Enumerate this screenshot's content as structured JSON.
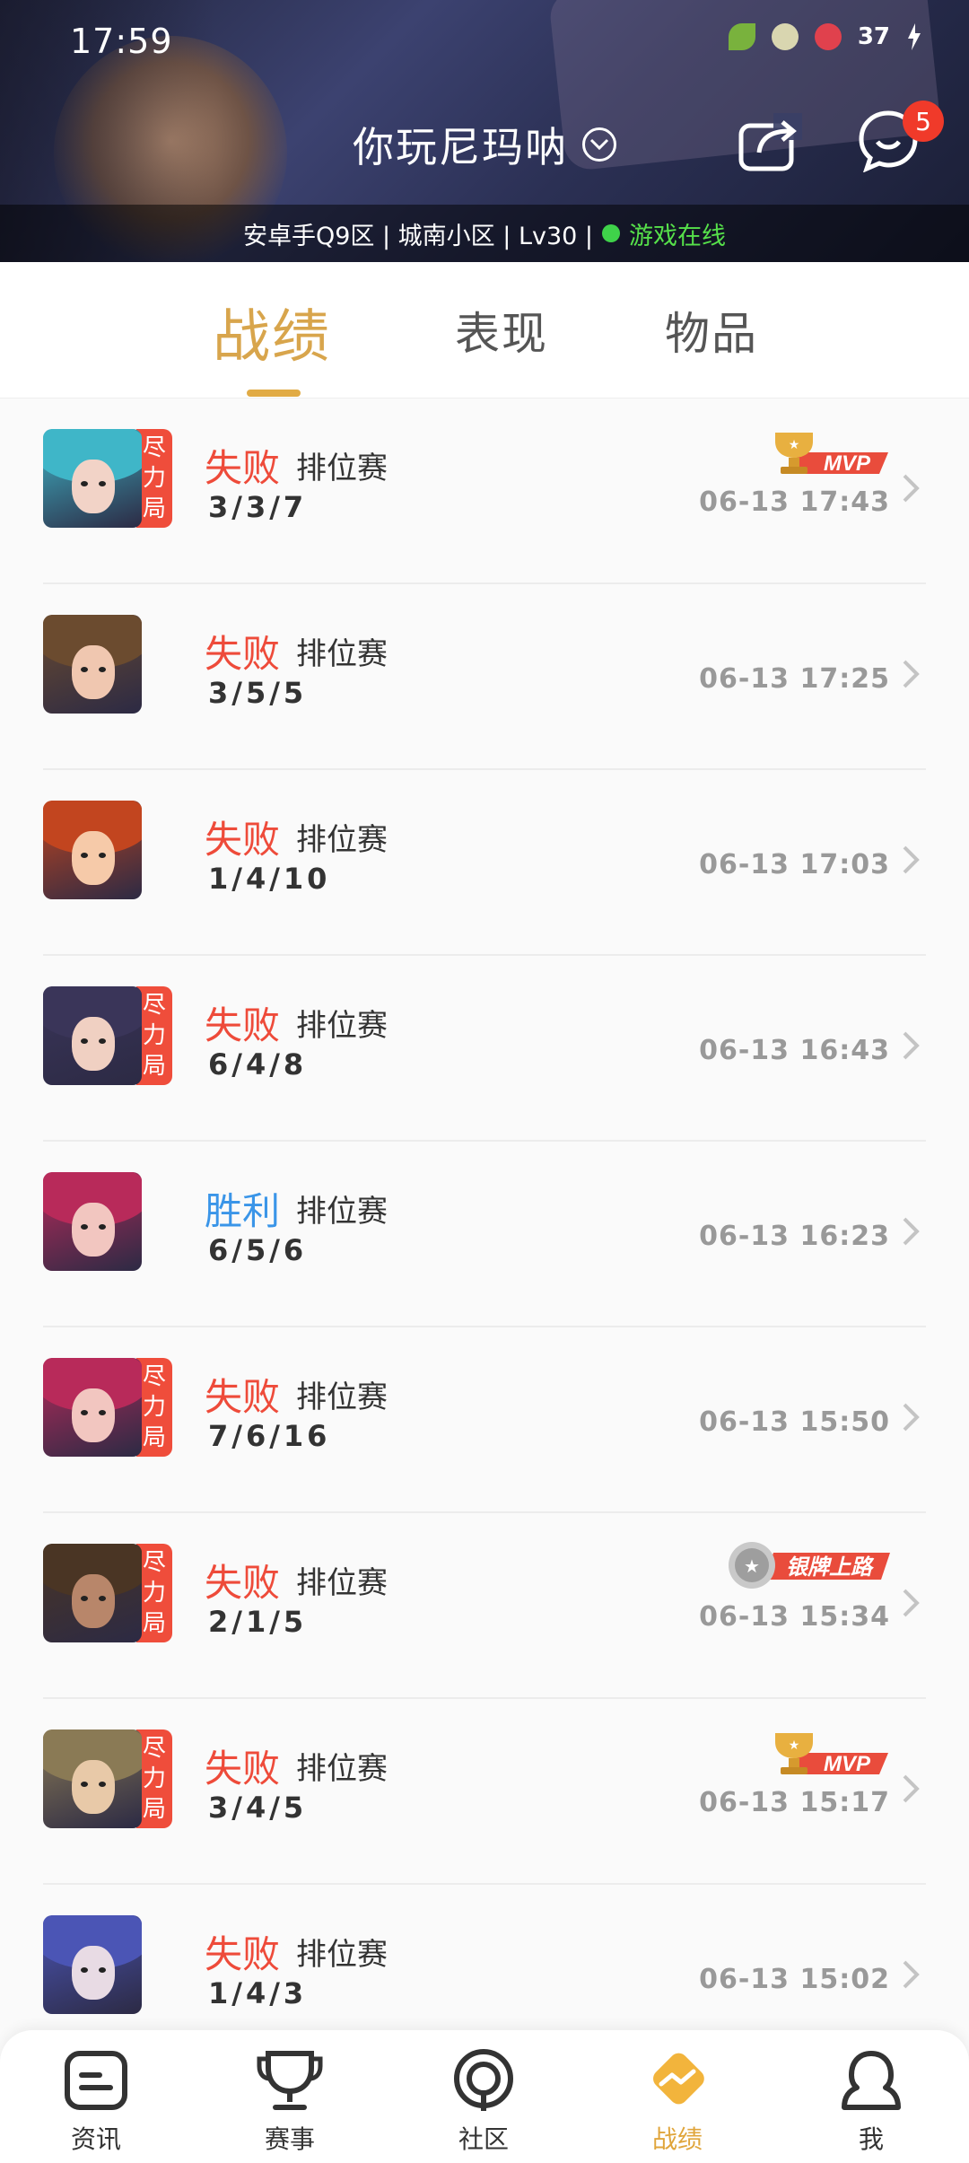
{
  "status_bar": {
    "time": "17:59",
    "battery": "37"
  },
  "header": {
    "username": "你玩尼玛呐",
    "message_badge": "5",
    "server_info": "安卓手Q9区 | 城南小区 | Lv30 |",
    "online_status": "游戏在线"
  },
  "tabs": [
    {
      "label": "战绩",
      "active": true
    },
    {
      "label": "表现",
      "active": false
    },
    {
      "label": "物品",
      "active": false
    }
  ],
  "matches": [
    {
      "result": "失败",
      "win": false,
      "mode": "排位赛",
      "kda": "3/3/7",
      "time": "06-13 17:43",
      "tag": "尽力局",
      "badge": "mvp",
      "avatar_colors": [
        "#3fb6c8",
        "#f2d3c7"
      ]
    },
    {
      "result": "失败",
      "win": false,
      "mode": "排位赛",
      "kda": "3/5/5",
      "time": "06-13 17:25",
      "tag": "",
      "badge": "",
      "avatar_colors": [
        "#6b4b2f",
        "#f0c7b0"
      ]
    },
    {
      "result": "失败",
      "win": false,
      "mode": "排位赛",
      "kda": "1/4/10",
      "time": "06-13 17:03",
      "tag": "",
      "badge": "",
      "avatar_colors": [
        "#c2451f",
        "#f6caa9"
      ]
    },
    {
      "result": "失败",
      "win": false,
      "mode": "排位赛",
      "kda": "6/4/8",
      "time": "06-13 16:43",
      "tag": "尽力局",
      "badge": "",
      "avatar_colors": [
        "#3a3559",
        "#f0d0c2"
      ]
    },
    {
      "result": "胜利",
      "win": true,
      "mode": "排位赛",
      "kda": "6/5/6",
      "time": "06-13 16:23",
      "tag": "",
      "badge": "",
      "avatar_colors": [
        "#b82a5a",
        "#f2c6c0"
      ]
    },
    {
      "result": "失败",
      "win": false,
      "mode": "排位赛",
      "kda": "7/6/16",
      "time": "06-13 15:50",
      "tag": "尽力局",
      "badge": "",
      "avatar_colors": [
        "#b82a5a",
        "#f2c6c0"
      ]
    },
    {
      "result": "失败",
      "win": false,
      "mode": "排位赛",
      "kda": "2/1/5",
      "time": "06-13 15:34",
      "tag": "尽力局",
      "badge": "silver",
      "badge_text": "银牌上路",
      "avatar_colors": [
        "#4a3524",
        "#b8866a"
      ]
    },
    {
      "result": "失败",
      "win": false,
      "mode": "排位赛",
      "kda": "3/4/5",
      "time": "06-13 15:17",
      "tag": "尽力局",
      "badge": "mvp",
      "avatar_colors": [
        "#8a7a55",
        "#e8c9a8"
      ]
    },
    {
      "result": "失败",
      "win": false,
      "mode": "排位赛",
      "kda": "1/4/3",
      "time": "06-13 15:02",
      "tag": "",
      "badge": "",
      "avatar_colors": [
        "#4b55b5",
        "#e8dbe4"
      ]
    }
  ],
  "mvp_text": "MVP",
  "bottom_nav": [
    {
      "label": "资讯",
      "icon": "news-icon",
      "active": false
    },
    {
      "label": "赛事",
      "icon": "trophy-icon",
      "active": false
    },
    {
      "label": "社区",
      "icon": "community-icon",
      "active": false
    },
    {
      "label": "战绩",
      "icon": "record-icon",
      "active": true
    },
    {
      "label": "我",
      "icon": "profile-icon",
      "active": false
    }
  ],
  "colors": {
    "accent": "#d8a54c",
    "lose": "#ee4b3a",
    "win": "#3a95e8",
    "tag": "#ef4d3b",
    "online": "#56e04a"
  }
}
